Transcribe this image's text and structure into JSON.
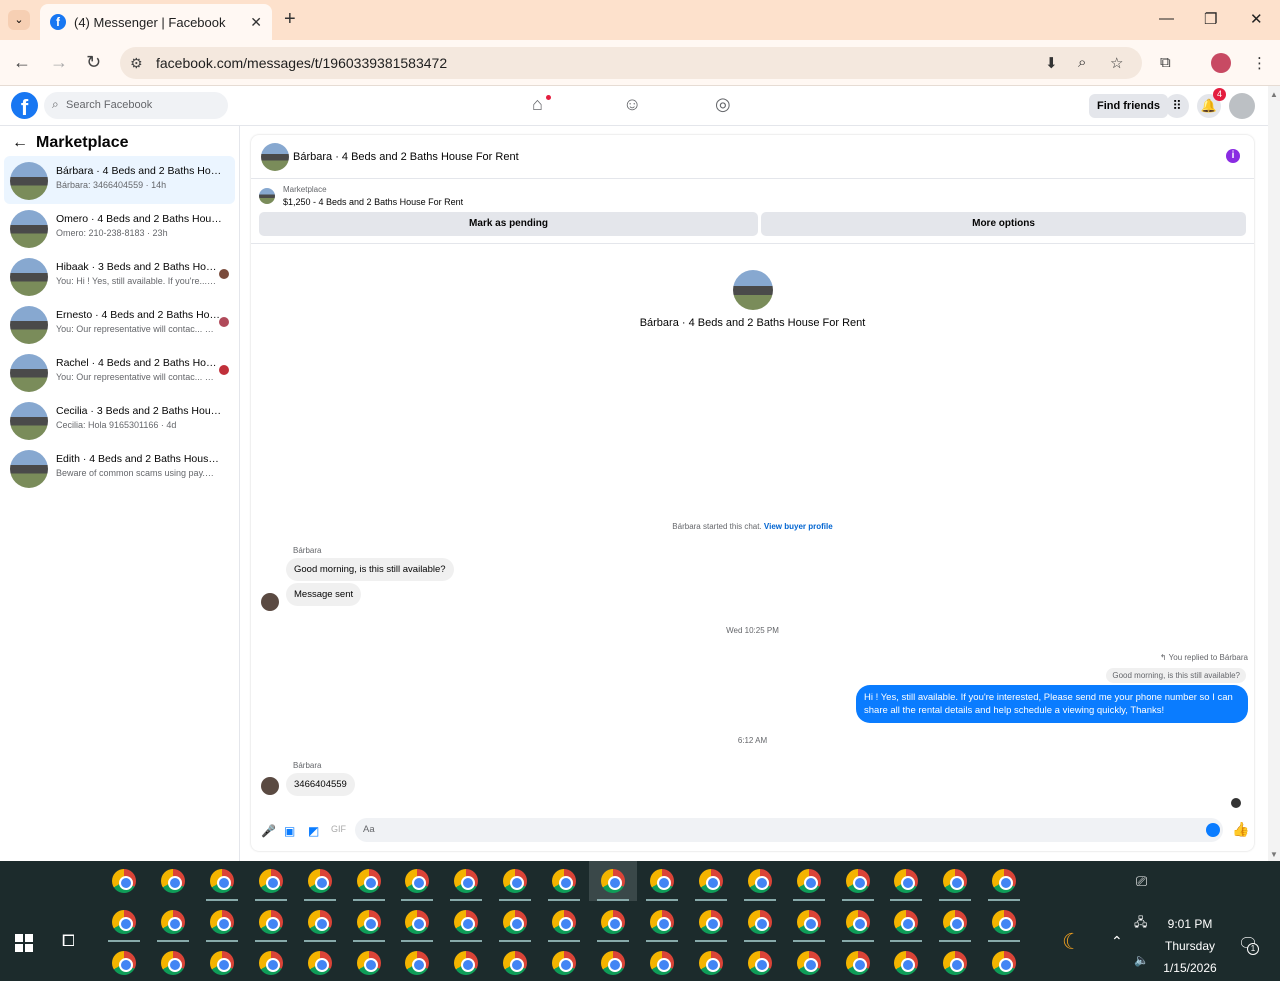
{
  "browser": {
    "tab_title": "(4) Messenger | Facebook",
    "url": "facebook.com/messages/t/1960339381583472"
  },
  "fb": {
    "search_placeholder": "Search Facebook",
    "find_friends": "Find friends",
    "notif_count": "4"
  },
  "sidebar": {
    "title": "Marketplace",
    "conversations": [
      {
        "name": "Bárbara · 4 Beds and 2 Baths House For Rent",
        "preview": "Bárbara: 3466404559 · 14h",
        "active": true
      },
      {
        "name": "Omero · 4 Beds and 2 Baths House For Rent",
        "preview": "Omero: 210-238-8183 · 23h"
      },
      {
        "name": "Hibaak · 3 Beds and 2 Baths House For Rent",
        "preview": "You: Hi ! Yes, still available. If you're... · 1d"
      },
      {
        "name": "Ernesto · 4 Beds and 2 Baths House For Rent",
        "preview": "You: Our representative will contac... · 4d"
      },
      {
        "name": "Rachel · 4 Beds and 2 Baths House For Rent",
        "preview": "You: Our representative will contac... · 4d"
      },
      {
        "name": "Cecilia · 3 Beds and 2 Baths House For Rent",
        "preview": "Cecilia: Hola 9165301166 · 4d"
      },
      {
        "name": "Edith · 4 Beds and 2 Baths House For Rent",
        "preview": "Beware of common scams using pay... · 5d"
      }
    ]
  },
  "chat": {
    "title": "Bárbara · 4 Beds and 2 Baths House For Rent",
    "marketplace_label": "Marketplace",
    "listing": "$1,250 - 4 Beds and 2 Baths House For Rent",
    "mark_pending": "Mark as pending",
    "more_options": "More options",
    "hero_title": "Bárbara · 4 Beds and 2 Baths House For Rent",
    "started_text": "Bárbara started this chat.",
    "view_buyer": "View buyer profile",
    "sender": "Bárbara",
    "msg1": "Good morning, is this still available?",
    "msg2": "Message sent",
    "time1": "Wed 10:25 PM",
    "replied_to": "You replied to Bárbara",
    "quoted": "Good morning, is this still available?",
    "reply": "Hi ! Yes, still available. If you're interested, Please send me your phone number so I can share all the rental details and help schedule a viewing quickly, Thanks!",
    "time2": "6:12 AM",
    "sender2": "Bárbara",
    "msg3": "3466404559",
    "composer_placeholder": "Aa"
  },
  "taskbar": {
    "time": "9:01 PM",
    "day": "Thursday",
    "date": "1/15/2026",
    "notif": "1"
  }
}
